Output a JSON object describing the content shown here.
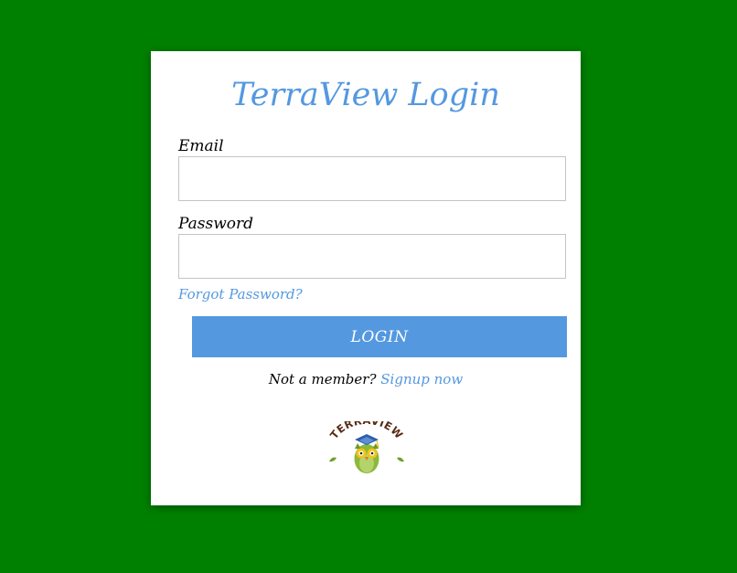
{
  "login": {
    "title": "TerraView Login",
    "email_label": "Email",
    "email_value": "",
    "password_label": "Password",
    "password_value": "",
    "forgot_password": "Forgot Password?",
    "login_button": "LOGIN",
    "not_member_text": "Not a member?",
    "signup_link": "Signup now"
  },
  "logo": {
    "text": "TERRAVIEW",
    "icon": "owl-icon"
  },
  "colors": {
    "background": "#008000",
    "accent": "#5498e0",
    "card": "#ffffff",
    "logo_text": "#5a2a14",
    "owl_body": "#8db83a"
  }
}
